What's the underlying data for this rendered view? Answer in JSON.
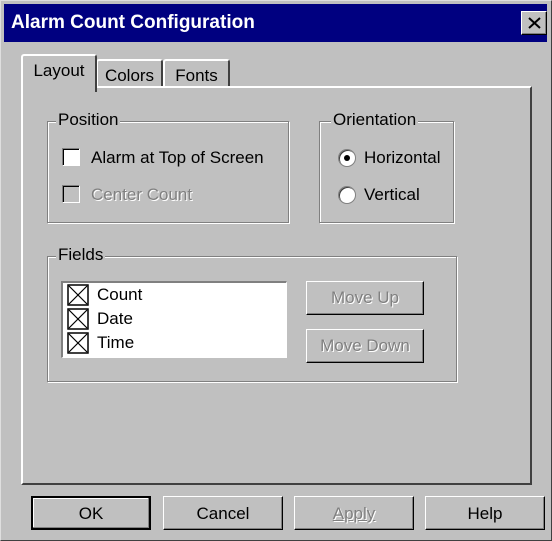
{
  "window": {
    "title": "Alarm Count Configuration"
  },
  "tabs": [
    {
      "label": "Layout",
      "active": true
    },
    {
      "label": "Colors",
      "active": false
    },
    {
      "label": "Fonts",
      "active": false
    }
  ],
  "position": {
    "legend": "Position",
    "alarm_top": {
      "label": "Alarm at Top of Screen",
      "checked": false
    },
    "center_count": {
      "label": "Center Count",
      "checked": false,
      "disabled": true
    }
  },
  "orientation": {
    "legend": "Orientation",
    "horizontal": {
      "label": "Horizontal",
      "selected": true
    },
    "vertical": {
      "label": "Vertical",
      "selected": false
    }
  },
  "fields": {
    "legend": "Fields",
    "items": [
      {
        "label": "Count",
        "checked": true
      },
      {
        "label": "Date",
        "checked": true
      },
      {
        "label": "Time",
        "checked": true
      }
    ],
    "move_up": "Move Up",
    "move_down": "Move Down"
  },
  "buttons": {
    "ok": "OK",
    "cancel": "Cancel",
    "apply": "Apply",
    "help": "Help"
  }
}
